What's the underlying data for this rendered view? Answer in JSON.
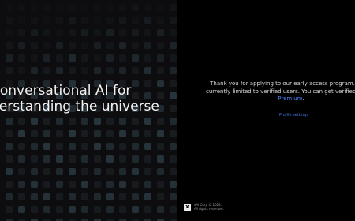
{
  "hero": {
    "line1": "Conversational AI for",
    "line2": "derstanding the universe"
  },
  "notice": {
    "line1": "Thank you for applying to our early access program. The p",
    "line2": "currently limited to verified users. You can get verified by sub",
    "premium": "Premium",
    "premium_suffix": "."
  },
  "links": {
    "profile_settings": "Profile settings"
  },
  "footer": {
    "logo_glyph": "x",
    "copyright": "xAI Corp © 2023.",
    "rights": "All rights reserved."
  },
  "colors": {
    "accent": "#4a7df0",
    "left_bg": "#0d0d0f",
    "right_bg": "#000000"
  }
}
